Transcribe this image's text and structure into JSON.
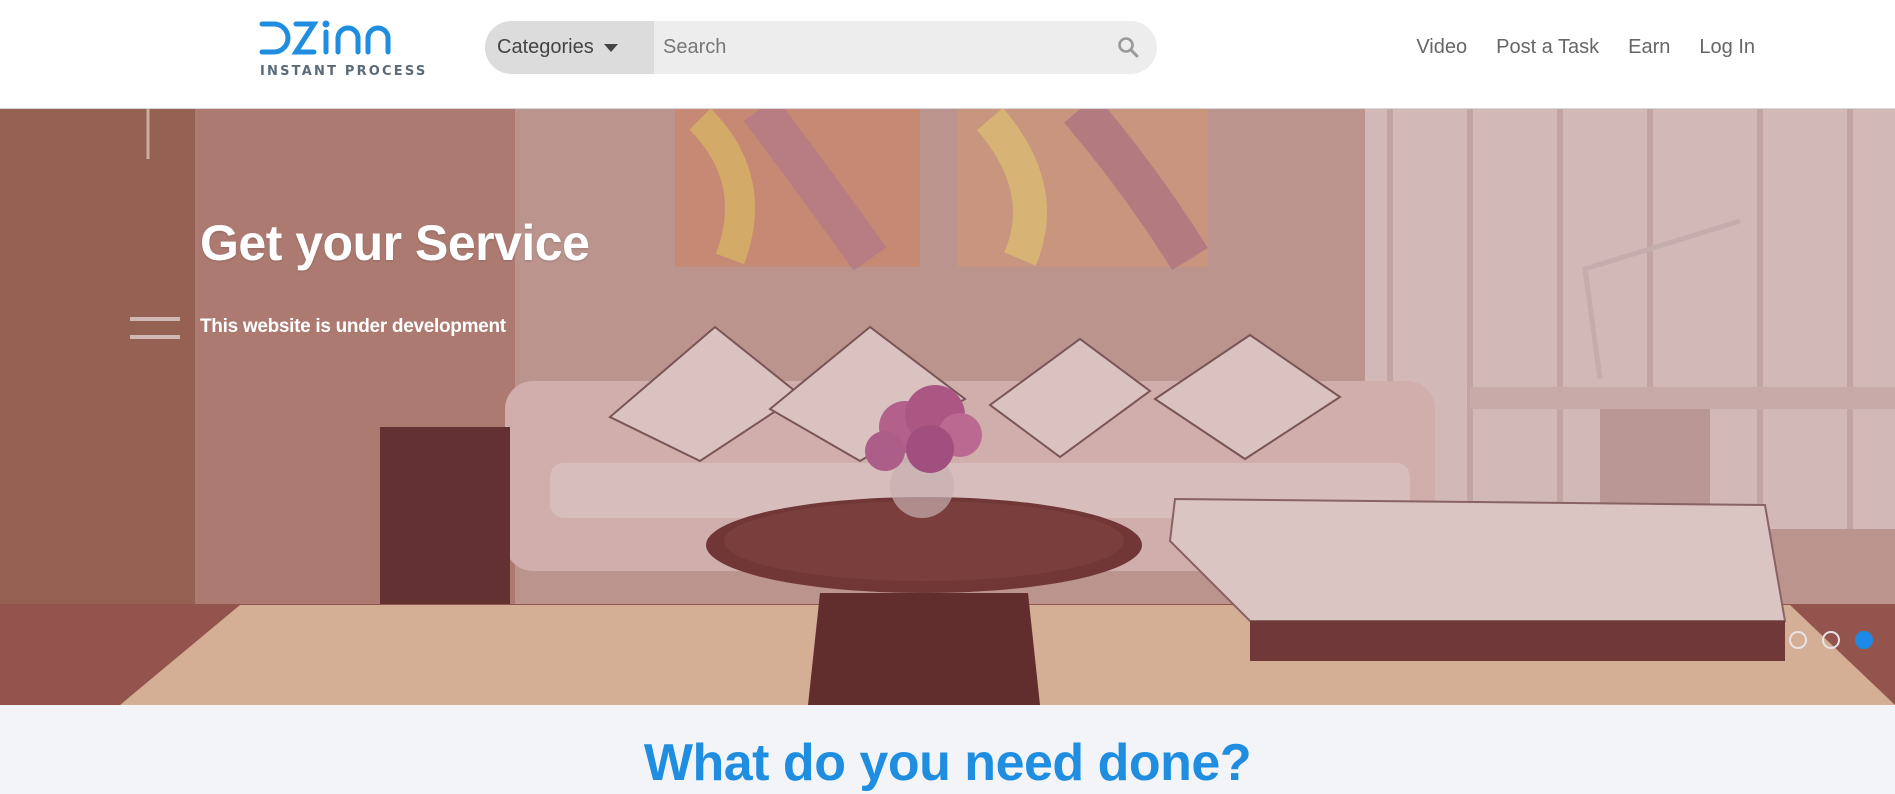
{
  "header": {
    "logo": {
      "wordmark": "DZINN",
      "tagline": "INSTANT PROCESS",
      "color": "#1f8ee0"
    },
    "search": {
      "category_label": "Categories",
      "placeholder": "Search",
      "icon": "search-icon"
    },
    "nav": [
      {
        "label": "Video"
      },
      {
        "label": "Post a Task"
      },
      {
        "label": "Earn"
      },
      {
        "label": "Log In"
      }
    ]
  },
  "hero": {
    "title": "Get your Service",
    "subtitle": "This website is under development",
    "slides": {
      "count": 3,
      "active": 3,
      "active_color": "#1e88e5"
    }
  },
  "section": {
    "title": "What do you need done?",
    "color": "#1f8ee0"
  }
}
